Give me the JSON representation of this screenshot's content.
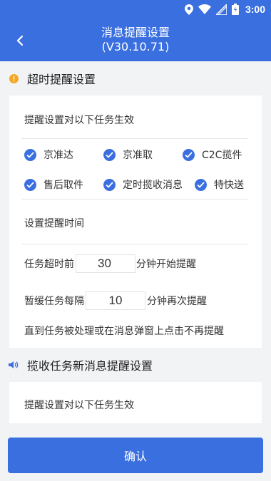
{
  "status_bar": {
    "time": "3:00"
  },
  "header": {
    "title": "消息提醒设置",
    "version": "(V30.10.71)"
  },
  "timeout_section": {
    "title": "超时提醒设置",
    "effective_label": "提醒设置对以下任务生效",
    "task_types": [
      "京准达",
      "京准取",
      "C2C揽件",
      "售后取件",
      "定时揽收消息",
      "特快送"
    ],
    "time_label": "设置提醒时间",
    "timeout_prefix": "任务超时前",
    "timeout_value": "30",
    "timeout_suffix": "分钟开始提醒",
    "snooze_prefix": "暂缓任务每隔",
    "snooze_value": "10",
    "snooze_suffix": "分钟再次提醒",
    "note": "直到任务被处理或在消息弹窗上点击不再提醒"
  },
  "pickup_section": {
    "title": "揽收任务新消息提醒设置",
    "effective_label": "提醒设置对以下任务生效"
  },
  "confirm_label": "确认",
  "colors": {
    "primary": "#3a6fe0",
    "warning": "#f5a623",
    "background": "#f2f3f5"
  }
}
